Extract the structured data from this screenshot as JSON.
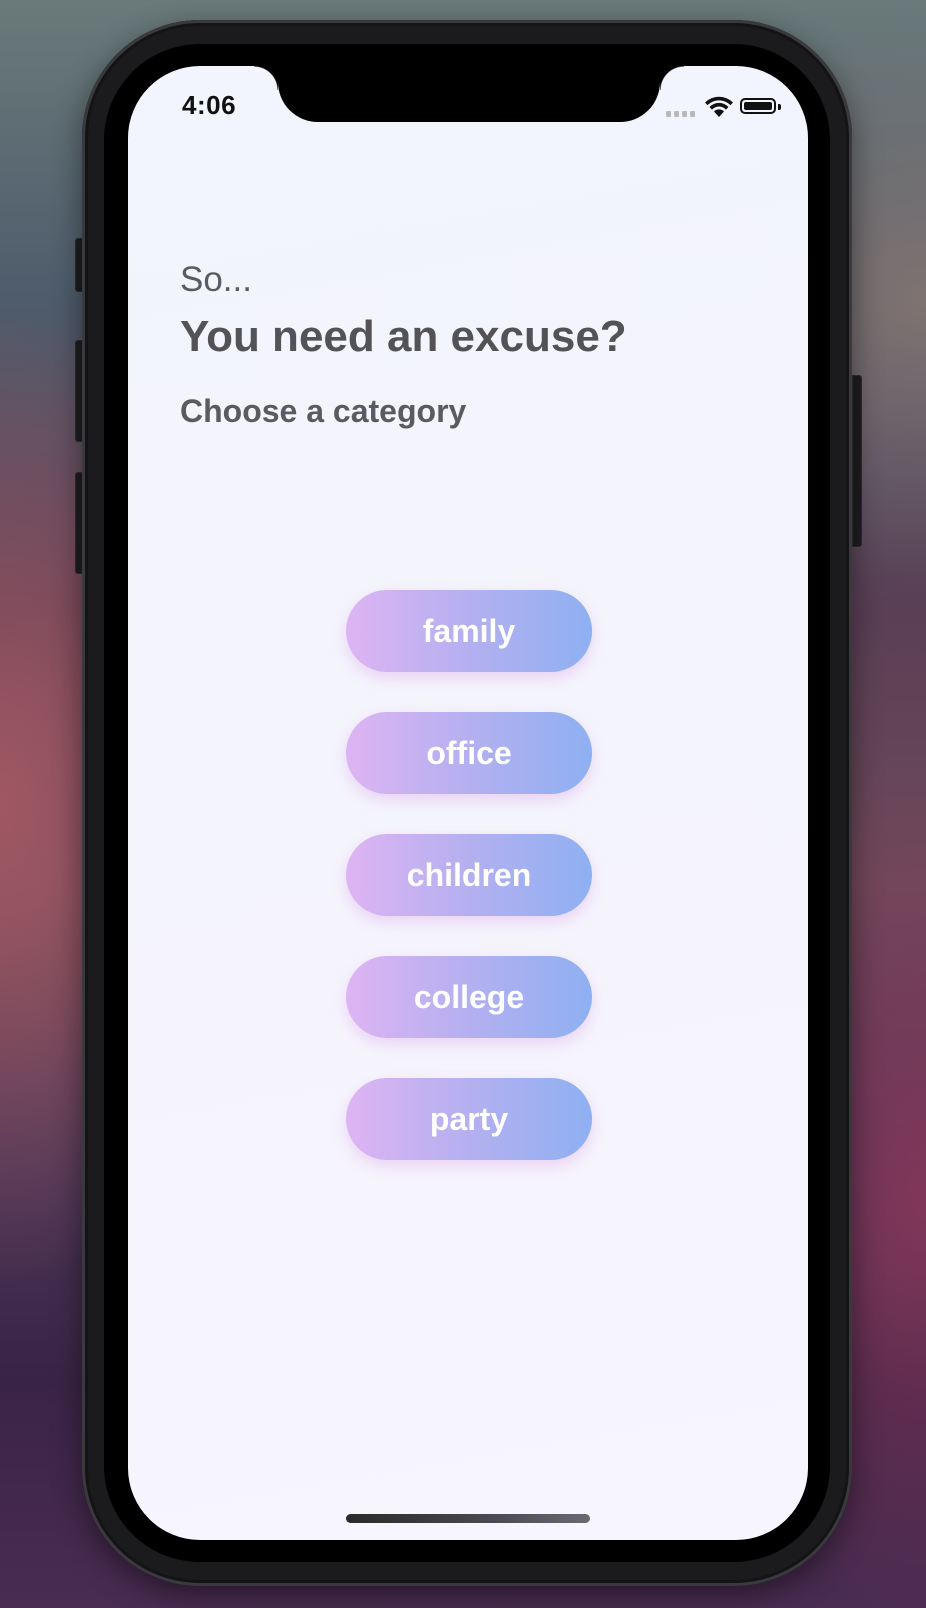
{
  "status_bar": {
    "time": "4:06",
    "battery_level": 1.0
  },
  "intro": {
    "line1": "So...",
    "headline": "You need an excuse?",
    "subheading": "Choose a category"
  },
  "categories": [
    {
      "label": "family"
    },
    {
      "label": "office"
    },
    {
      "label": "children"
    },
    {
      "label": "college"
    },
    {
      "label": "party"
    }
  ],
  "colors": {
    "button_gradient_start": "#deb4f3",
    "button_gradient_end": "#8eb0f2",
    "text_primary": "#56565b",
    "screen_background": "#f4f4fc"
  }
}
